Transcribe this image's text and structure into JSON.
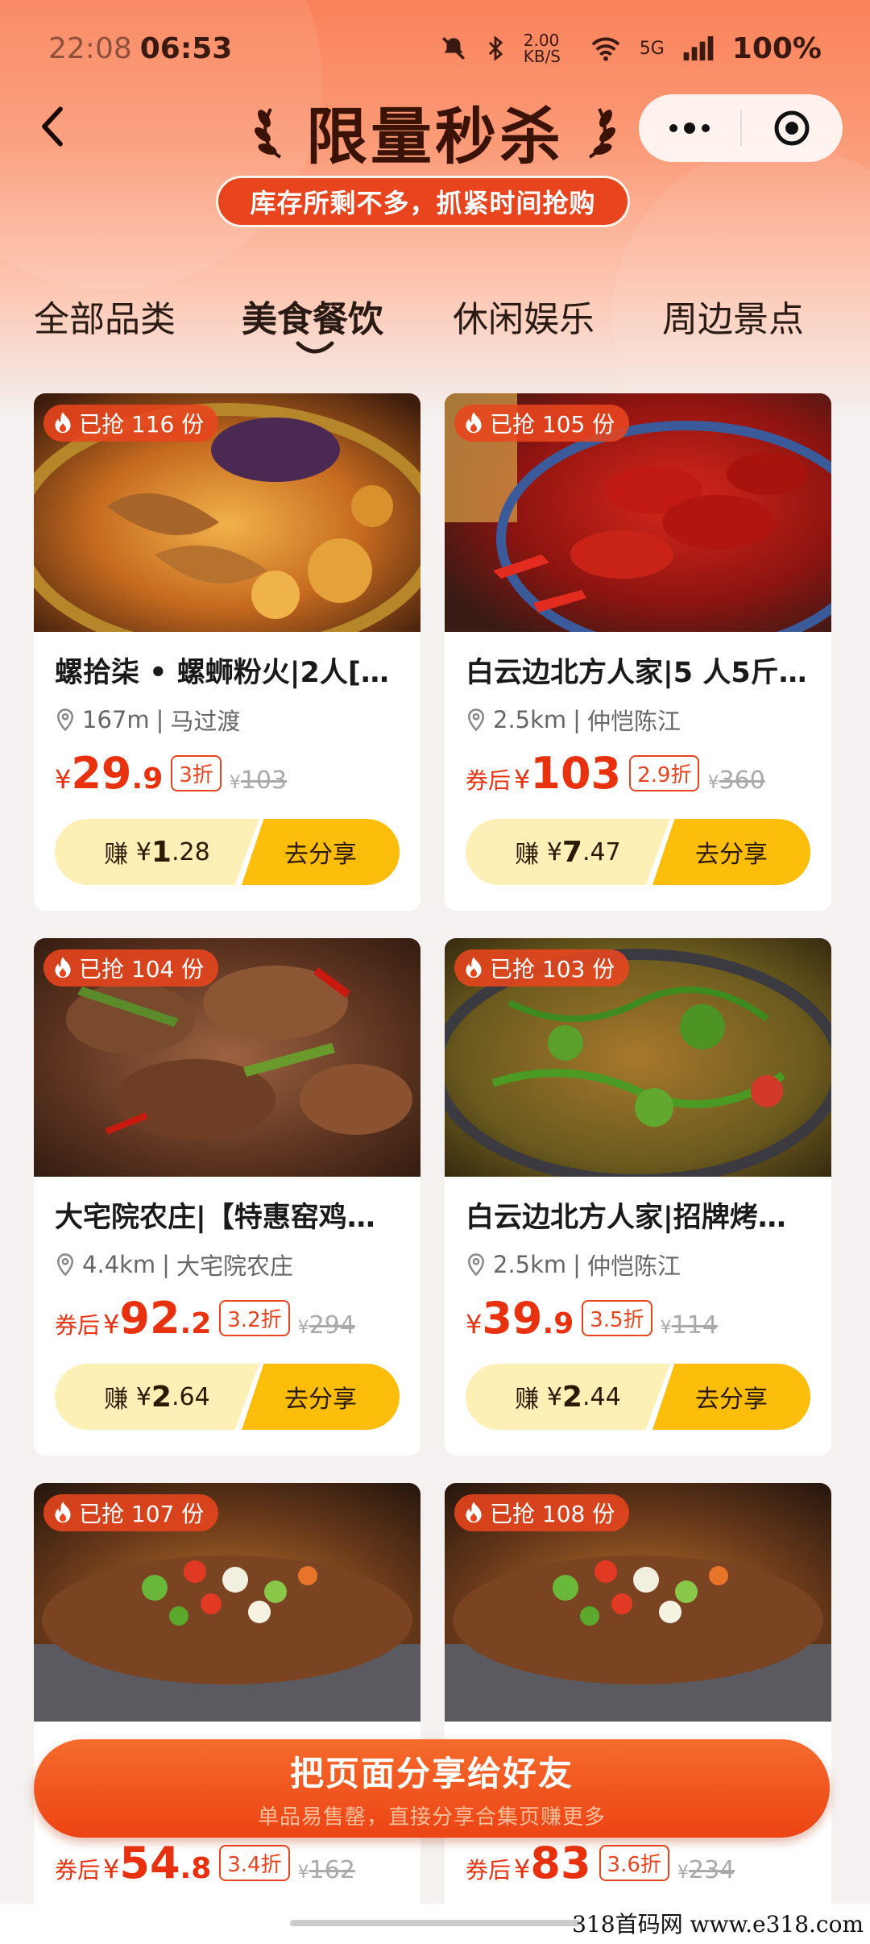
{
  "status_bar": {
    "time_secondary": "22:08",
    "time_primary": "06:53",
    "net_speed": "2.00 KB/S",
    "net_type": "5G",
    "battery": "100%"
  },
  "header": {
    "title": "限量秒杀",
    "subtitle": "库存所剩不多，抓紧时间抢购"
  },
  "tabs": [
    {
      "label": "全部品类",
      "active": false
    },
    {
      "label": "美食餐饮",
      "active": true
    },
    {
      "label": "休闲娱乐",
      "active": false
    },
    {
      "label": "周边景点",
      "active": false
    }
  ],
  "products": [
    {
      "sold": "已抢 116 份",
      "title": "螺拾柒 • 螺蛳粉火|2人[…",
      "distance": "167m",
      "place": "马过渡",
      "prefix": "",
      "price_int": "29",
      "price_dec": ".9",
      "discount": "3折",
      "original": "103",
      "earn_int": "1",
      "earn_dec": ".28",
      "share": "去分享"
    },
    {
      "sold": "已抢 105 份",
      "title": "白云边北方人家|5 人5斤…",
      "distance": "2.5km",
      "place": "仲恺陈江",
      "prefix": "券后",
      "price_int": "103",
      "price_dec": "",
      "discount": "2.9折",
      "original": "360",
      "earn_int": "7",
      "earn_dec": ".47",
      "share": "去分享"
    },
    {
      "sold": "已抢 104 份",
      "title": "大宅院农庄|【特惠窑鸡…",
      "distance": "4.4km",
      "place": "大宅院农庄",
      "prefix": "券后",
      "price_int": "92",
      "price_dec": ".2",
      "discount": "3.2折",
      "original": "294",
      "earn_int": "2",
      "earn_dec": ".64",
      "share": "去分享"
    },
    {
      "sold": "已抢 103 份",
      "title": "白云边北方人家|招牌烤…",
      "distance": "2.5km",
      "place": "仲恺陈江",
      "prefix": "",
      "price_int": "39",
      "price_dec": ".9",
      "discount": "3.5折",
      "original": "114",
      "earn_int": "2",
      "earn_dec": ".44",
      "share": "去分享"
    },
    {
      "sold": "已抢 107 份",
      "prefix": "券后",
      "price_int": "54",
      "price_dec": ".8",
      "discount": "3.4折",
      "original": "162"
    },
    {
      "sold": "已抢 108 份",
      "prefix": "券后",
      "price_int": "83",
      "price_dec": "",
      "discount": "3.6折",
      "original": "234"
    }
  ],
  "cta": {
    "main": "把页面分享给好友",
    "sub": "单品易售罄，直接分享合集页赚更多"
  },
  "currency": "¥",
  "earn_label": "赚",
  "watermark": "318首码网  www.e318.com",
  "colors": {
    "accent": "#e8451e",
    "price": "#e8310f",
    "share_button": "#fdbd0b",
    "earn_bg": "#fdf0b7"
  }
}
